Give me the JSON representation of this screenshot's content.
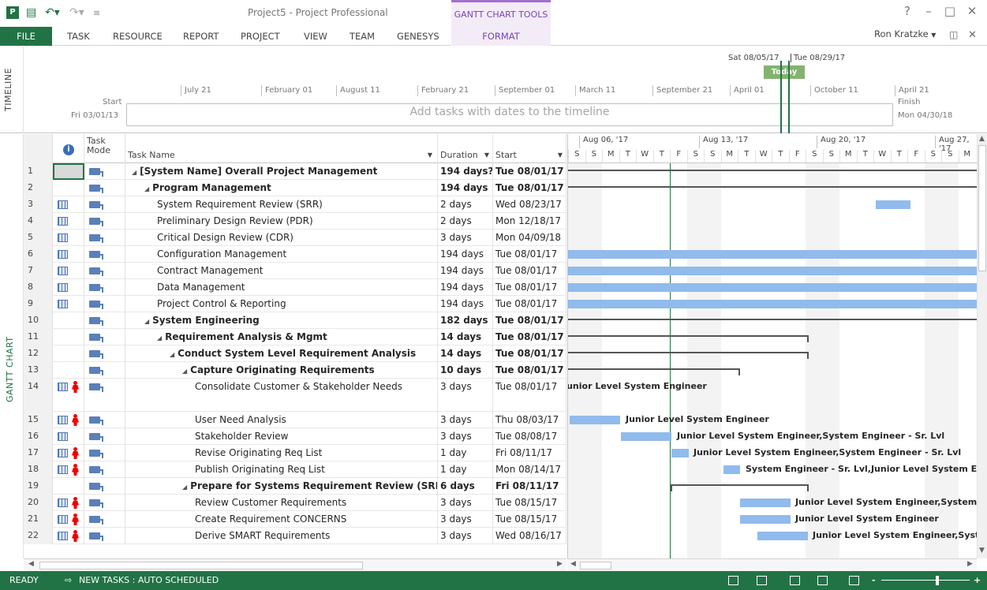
{
  "window": {
    "title": "Project5 - Project Professional",
    "context_group": "GANTT CHART TOOLS",
    "user": "Ron Kratzke",
    "help": "?"
  },
  "tabs": {
    "file": "FILE",
    "items": [
      "TASK",
      "RESOURCE",
      "REPORT",
      "PROJECT",
      "VIEW",
      "TEAM",
      "GENESYS"
    ],
    "format": "FORMAT"
  },
  "timeline": {
    "side_label": "TIMELINE",
    "start_label": "Start",
    "start_date": "Fri 03/01/13",
    "finish_label": "Finish",
    "finish_date": "Mon 04/30/18",
    "today": "Today",
    "hint": "Add tasks with dates to the timeline",
    "view_start": "Sat 08/05/17",
    "view_end": "Tue 08/29/17",
    "ticks": [
      "July 21",
      "February 01",
      "August 11",
      "February 21",
      "September 01",
      "March 11",
      "September 21",
      "April 01",
      "October 11",
      "April 21"
    ]
  },
  "gantt_side_label": "GANTT CHART",
  "columns": {
    "mode": "Task Mode",
    "name": "Task Name",
    "duration": "Duration",
    "start": "Start"
  },
  "rows": [
    {
      "id": "1",
      "name": "[System Name] Overall Project Management",
      "duration": "194 days?",
      "start": "Tue 08/01/17",
      "level": 0,
      "summary": true,
      "cal": false,
      "res": false
    },
    {
      "id": "2",
      "name": "Program Management",
      "duration": "194 days",
      "start": "Tue 08/01/17",
      "level": 1,
      "summary": true,
      "cal": false,
      "res": false
    },
    {
      "id": "3",
      "name": "System Requirement Review (SRR)",
      "duration": "2 days",
      "start": "Wed 08/23/17",
      "level": 2,
      "summary": false,
      "cal": true,
      "res": false
    },
    {
      "id": "4",
      "name": "Preliminary Design Review (PDR)",
      "duration": "2 days",
      "start": "Mon 12/18/17",
      "level": 2,
      "summary": false,
      "cal": true,
      "res": false
    },
    {
      "id": "5",
      "name": "Critical Design Review (CDR)",
      "duration": "3 days",
      "start": "Mon 04/09/18",
      "level": 2,
      "summary": false,
      "cal": true,
      "res": false
    },
    {
      "id": "6",
      "name": "Configuration Management",
      "duration": "194 days",
      "start": "Tue 08/01/17",
      "level": 2,
      "summary": false,
      "cal": true,
      "res": false
    },
    {
      "id": "7",
      "name": "Contract Management",
      "duration": "194 days",
      "start": "Tue 08/01/17",
      "level": 2,
      "summary": false,
      "cal": true,
      "res": false
    },
    {
      "id": "8",
      "name": "Data Management",
      "duration": "194 days",
      "start": "Tue 08/01/17",
      "level": 2,
      "summary": false,
      "cal": true,
      "res": false
    },
    {
      "id": "9",
      "name": "Project Control & Reporting",
      "duration": "194 days",
      "start": "Tue 08/01/17",
      "level": 2,
      "summary": false,
      "cal": true,
      "res": false
    },
    {
      "id": "10",
      "name": "System Engineering",
      "duration": "182 days",
      "start": "Tue 08/01/17",
      "level": 1,
      "summary": true,
      "cal": false,
      "res": false
    },
    {
      "id": "11",
      "name": "Requirement Analysis & Mgmt",
      "duration": "14 days",
      "start": "Tue 08/01/17",
      "level": 2,
      "summary": true,
      "cal": false,
      "res": false
    },
    {
      "id": "12",
      "name": "Conduct System Level Requirement Analysis",
      "duration": "14 days",
      "start": "Tue 08/01/17",
      "level": 3,
      "summary": true,
      "cal": false,
      "res": false
    },
    {
      "id": "13",
      "name": "Capture Originating Requirements",
      "duration": "10 days",
      "start": "Tue 08/01/17",
      "level": 4,
      "summary": true,
      "cal": false,
      "res": false
    },
    {
      "id": "14",
      "name": "Consolidate Customer & Stakeholder Needs",
      "duration": "3 days",
      "start": "Tue 08/01/17",
      "level": 5,
      "summary": false,
      "cal": true,
      "res": true,
      "tall": true
    },
    {
      "id": "15",
      "name": "User Need Analysis",
      "duration": "3 days",
      "start": "Thu 08/03/17",
      "level": 5,
      "summary": false,
      "cal": true,
      "res": true
    },
    {
      "id": "16",
      "name": "Stakeholder Review",
      "duration": "3 days",
      "start": "Tue 08/08/17",
      "level": 5,
      "summary": false,
      "cal": true,
      "res": false
    },
    {
      "id": "17",
      "name": "Revise Originating Req List",
      "duration": "1 day",
      "start": "Fri 08/11/17",
      "level": 5,
      "summary": false,
      "cal": true,
      "res": true
    },
    {
      "id": "18",
      "name": "Publish Originating Req List",
      "duration": "1 day",
      "start": "Mon 08/14/17",
      "level": 5,
      "summary": false,
      "cal": true,
      "res": true
    },
    {
      "id": "19",
      "name": "Prepare for Systems Requirement Review (SRR)",
      "duration": "6 days",
      "start": "Fri 08/11/17",
      "level": 4,
      "summary": true,
      "cal": false,
      "res": false
    },
    {
      "id": "20",
      "name": "Review Customer Requirements",
      "duration": "3 days",
      "start": "Tue 08/15/17",
      "level": 5,
      "summary": false,
      "cal": true,
      "res": true
    },
    {
      "id": "21",
      "name": "Create Requirement CONCERNS",
      "duration": "3 days",
      "start": "Tue 08/15/17",
      "level": 5,
      "summary": false,
      "cal": true,
      "res": true
    },
    {
      "id": "22",
      "name": "Derive SMART Requirements",
      "duration": "3 days",
      "start": "Wed 08/16/17",
      "level": 5,
      "summary": false,
      "cal": true,
      "res": true
    }
  ],
  "chart": {
    "weeks": [
      "Aug 06, '17",
      "Aug 13, '17",
      "Aug 20, '17",
      "Aug 27, '17"
    ],
    "days": [
      "S",
      "S",
      "M",
      "T",
      "W",
      "T",
      "F",
      "S",
      "S",
      "M",
      "T",
      "W",
      "T",
      "F",
      "S",
      "S",
      "M",
      "T",
      "W",
      "T",
      "F",
      "S",
      "S",
      "M"
    ],
    "labels": {
      "r14": "Junior Level System Engineer",
      "r15": "Junior Level System Engineer",
      "r16": "Junior Level System Engineer,System Engineer - Sr. Lvl",
      "r17": "Junior Level System Engineer,System Engineer - Sr. Lvl",
      "r18": "System Engineer - Sr. Lvl,Junior Level System Engineer",
      "r20": "Junior Level System Engineer,System Engineer",
      "r21": "Junior Level System Engineer",
      "r22": "Junior Level System Engineer,System Engineer"
    }
  },
  "status": {
    "ready": "READY",
    "mode": "NEW TASKS : AUTO SCHEDULED"
  },
  "colors": {
    "brand": "#217346",
    "bar": "#91bbec",
    "context": "#7a43b6"
  }
}
